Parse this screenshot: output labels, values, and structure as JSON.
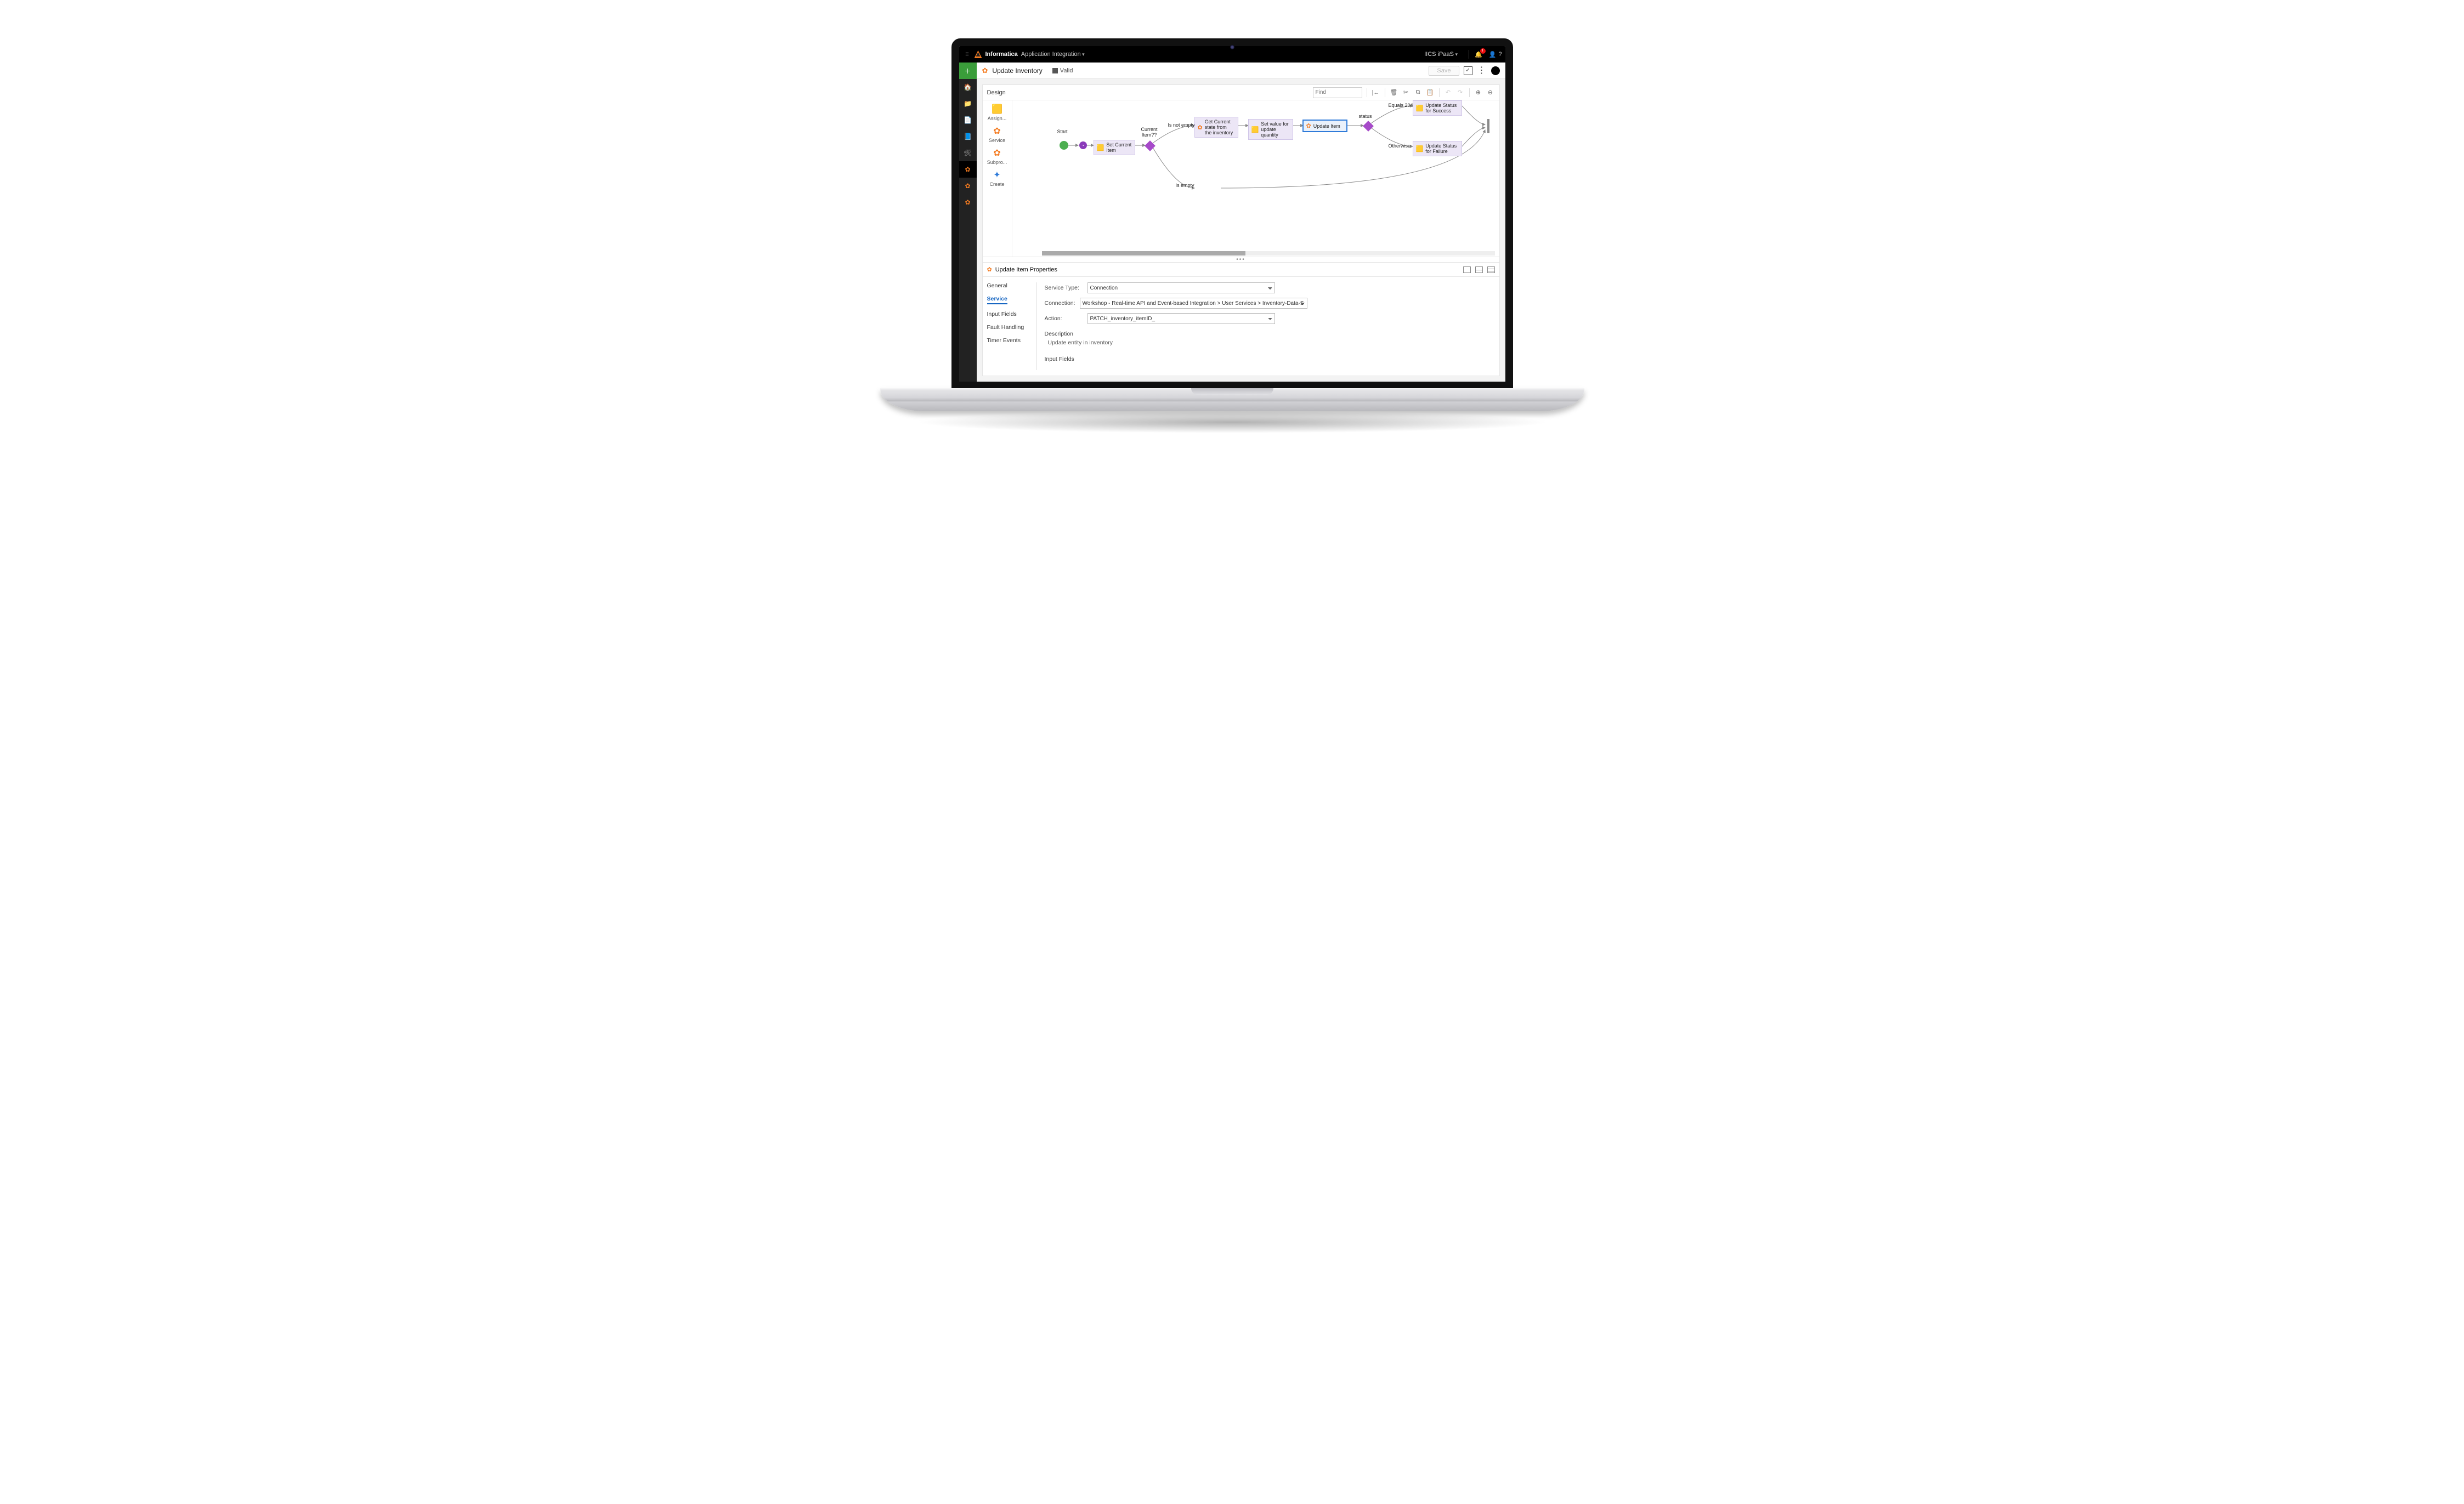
{
  "topbar": {
    "brand": "Informatica",
    "context": "Application Integration",
    "environment": "IICS iPaaS",
    "notification_count": "!"
  },
  "titlebar": {
    "page_title": "Update Inventory",
    "status": "Valid",
    "save_label": "Save"
  },
  "design": {
    "header_label": "Design",
    "find_placeholder": "Find"
  },
  "palette": {
    "items": [
      {
        "label": "Assign..."
      },
      {
        "label": "Service"
      },
      {
        "label": "Subpro..."
      },
      {
        "label": "Create"
      }
    ]
  },
  "flow": {
    "start_label": "Start",
    "set_current": "Set Current Item",
    "gateway1": "Current Item??",
    "branch_not_empty": "Is not empty",
    "branch_empty": "Is empty",
    "get_state": "Get Current state from the inventory",
    "set_value": "Set value for update quantity",
    "update_item": "Update Item",
    "status_label": "status",
    "branch_204": "Equals 204",
    "branch_otherwise": "Otherwise",
    "upd_success": "Update Status for Success",
    "upd_failure": "Update Status for Failure"
  },
  "properties": {
    "title": "Update Item Properties",
    "tabs": {
      "general": "General",
      "service": "Service",
      "input_fields": "Input Fields",
      "fault_handling": "Fault Handling",
      "timer_events": "Timer Events"
    },
    "form": {
      "service_type_label": "Service Type:",
      "service_type_value": "Connection",
      "connection_label": "Connection:",
      "connection_value": "Workshop - Real-time API and Event-based Integration > User Services > Inventory-Data-S",
      "action_label": "Action:",
      "action_value": "PATCH_inventory_itemID_",
      "description_label": "Description",
      "description_text": "Update entity in inventory",
      "input_fields_label": "Input Fields"
    }
  }
}
